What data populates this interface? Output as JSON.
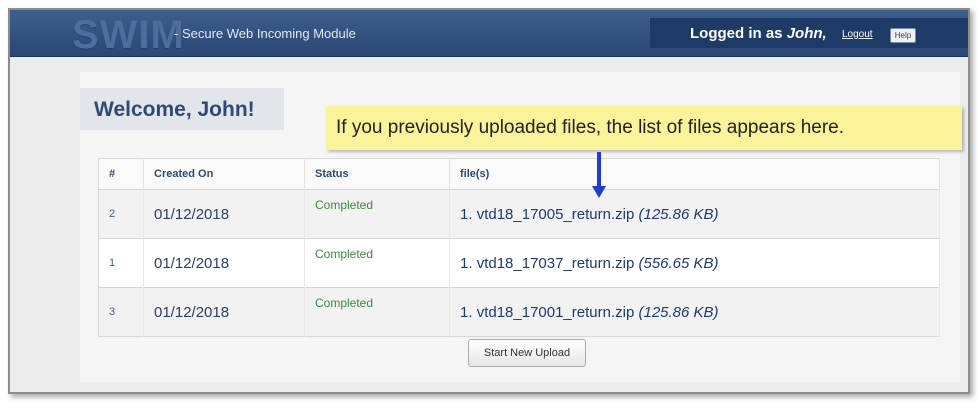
{
  "header": {
    "logo": "SWIM",
    "tagline": "- Secure Web Incoming Module",
    "logged_in_prefix": "Logged in as ",
    "user": "John,",
    "logout": "Logout",
    "help": "Help"
  },
  "welcome": "Welcome, John!",
  "callout": "If you previously uploaded files, the list of files appears here.",
  "table": {
    "columns": [
      "#",
      "Created On",
      "Status",
      "file(s)"
    ],
    "rows": [
      {
        "num": "2",
        "created": "01/12/2018",
        "status": "Completed",
        "file_index": "1.",
        "file_name": "vtd18_17005_return.zip",
        "file_size": "(125.86 KB)"
      },
      {
        "num": "1",
        "created": "01/12/2018",
        "status": "Completed",
        "file_index": "1.",
        "file_name": "vtd18_17037_return.zip",
        "file_size": "(556.65 KB)"
      },
      {
        "num": "3",
        "created": "01/12/2018",
        "status": "Completed",
        "file_index": "1.",
        "file_name": "vtd18_17001_return.zip",
        "file_size": "(125.86 KB)"
      }
    ]
  },
  "upload_button": "Start New Upload"
}
